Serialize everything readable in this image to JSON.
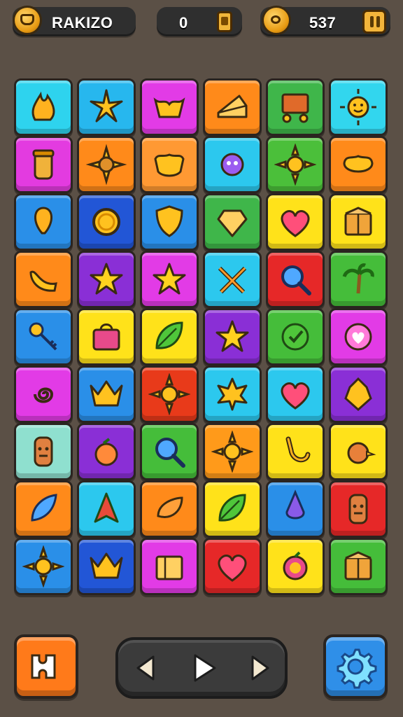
{
  "hud": {
    "player_name": "RAKIZO",
    "moves": "0",
    "score": "537"
  },
  "icons": {
    "avatar": "coin-avatar-icon",
    "moves_badge": "card-icon",
    "score_badge": "speech-coin-icon",
    "pause": "pause-icon"
  },
  "board": {
    "columns": 6,
    "rows": 9,
    "tiles": [
      {
        "color": "#2ed3ee",
        "icon": "flame-icon"
      },
      {
        "color": "#27b7ee",
        "icon": "star-burst-icon"
      },
      {
        "color": "#e23be6",
        "icon": "crown-leaf-icon"
      },
      {
        "color": "#ff8a1a",
        "icon": "cheese-icon"
      },
      {
        "color": "#3fb64a",
        "icon": "cart-icon"
      },
      {
        "color": "#32d6ee",
        "icon": "sun-face-icon"
      },
      {
        "color": "#e33be0",
        "icon": "jar-icon"
      },
      {
        "color": "#ff8a1a",
        "icon": "sunflower-icon"
      },
      {
        "color": "#ff9933",
        "icon": "bowl-icon"
      },
      {
        "color": "#2cc8ee",
        "icon": "monster-icon"
      },
      {
        "color": "#4bbf3a",
        "icon": "sun-icon"
      },
      {
        "color": "#ff8a1a",
        "icon": "dish-icon"
      },
      {
        "color": "#2a8fe8",
        "icon": "balloon-icon"
      },
      {
        "color": "#2256d6",
        "icon": "coin-icon"
      },
      {
        "color": "#2a8fe8",
        "icon": "shield-icon"
      },
      {
        "color": "#3fb64a",
        "icon": "gem-icon"
      },
      {
        "color": "#ffe21a",
        "icon": "heart-icon"
      },
      {
        "color": "#ffe21a",
        "icon": "crate-icon"
      },
      {
        "color": "#ff8a1a",
        "icon": "horn-icon"
      },
      {
        "color": "#8a2fd6",
        "icon": "star-icon"
      },
      {
        "color": "#e23be6",
        "icon": "star-icon"
      },
      {
        "color": "#2cc8ee",
        "icon": "crossed-sticks-icon"
      },
      {
        "color": "#e62828",
        "icon": "magnifier-icon"
      },
      {
        "color": "#45bd3a",
        "icon": "palm-tree-icon"
      },
      {
        "color": "#2a8fe8",
        "icon": "key-icon"
      },
      {
        "color": "#ffe21a",
        "icon": "bag-icon"
      },
      {
        "color": "#ffe21a",
        "icon": "leaf-icon"
      },
      {
        "color": "#8a2fd6",
        "icon": "star-icon"
      },
      {
        "color": "#45bd3a",
        "icon": "target-icon"
      },
      {
        "color": "#e23be6",
        "icon": "heart-bubble-icon"
      },
      {
        "color": "#e23be6",
        "icon": "spiral-icon"
      },
      {
        "color": "#2a8fe8",
        "icon": "crown-icon"
      },
      {
        "color": "#e83a1a",
        "icon": "sun-icon"
      },
      {
        "color": "#2cc8ee",
        "icon": "maple-leaf-icon"
      },
      {
        "color": "#2cc8ee",
        "icon": "heart-icon"
      },
      {
        "color": "#8a2fd6",
        "icon": "crest-icon"
      },
      {
        "color": "#8fe0cf",
        "icon": "totem-icon"
      },
      {
        "color": "#8a2fd6",
        "icon": "pot-icon"
      },
      {
        "color": "#45bd3a",
        "icon": "magnifier-icon"
      },
      {
        "color": "#ff9a1a",
        "icon": "sun-icon"
      },
      {
        "color": "#ffe21a",
        "icon": "hook-icon"
      },
      {
        "color": "#ffe21a",
        "icon": "bird-icon"
      },
      {
        "color": "#ff8a1a",
        "icon": "feather-icon"
      },
      {
        "color": "#2cc8ee",
        "icon": "arrowhead-icon"
      },
      {
        "color": "#ff8a1a",
        "icon": "seed-icon"
      },
      {
        "color": "#ffe21a",
        "icon": "leaf-icon"
      },
      {
        "color": "#2a8fe8",
        "icon": "drop-icon"
      },
      {
        "color": "#e62828",
        "icon": "totem-icon"
      },
      {
        "color": "#2a8fe8",
        "icon": "sun-icon"
      },
      {
        "color": "#2256d6",
        "icon": "crown-icon"
      },
      {
        "color": "#e23be6",
        "icon": "box-icon"
      },
      {
        "color": "#e62828",
        "icon": "heart-icon"
      },
      {
        "color": "#ffe21a",
        "icon": "apple-icon"
      },
      {
        "color": "#45bd3a",
        "icon": "crate-icon"
      }
    ]
  },
  "controls": {
    "left_button": {
      "color": "#ff7a1a",
      "icon": "puzzle-icon"
    },
    "nav_icons": [
      "arrow-left-icon",
      "play-icon",
      "arrow-right-icon"
    ],
    "right_button": {
      "color": "#2f8fe8",
      "icon": "gear-icon"
    }
  }
}
